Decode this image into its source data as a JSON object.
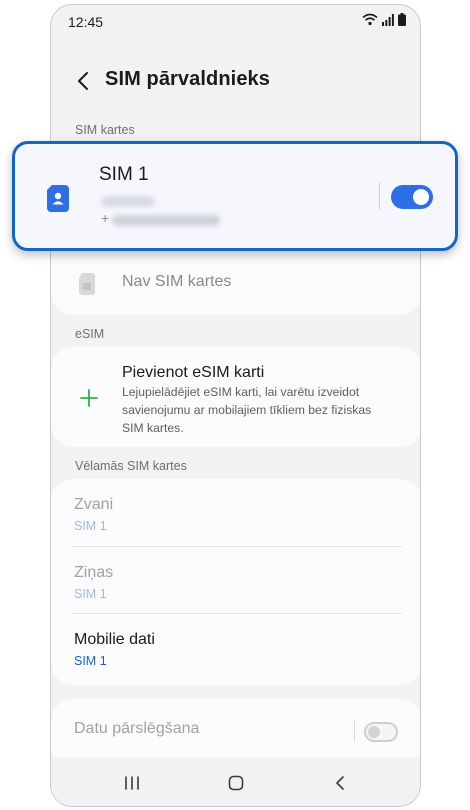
{
  "status_bar": {
    "time": "12:45"
  },
  "header": {
    "title": "SIM pārvaldnieks"
  },
  "sim_cards": {
    "section_label": "SIM kartes",
    "sim1": {
      "title": "SIM 1",
      "number_prefix": "+",
      "enabled": true
    },
    "no_sim": {
      "label": "Nav SIM kartes"
    }
  },
  "esim": {
    "section_label": "eSIM",
    "add_title": "Pievienot eSIM karti",
    "add_desc_line1": "Lejupielādējiet eSIM karti, lai varētu izveidot",
    "add_desc_line2": "savienojumu ar mobilajiem tīkliem bez fiziskas",
    "add_desc_line3": "SIM kartes."
  },
  "preferred": {
    "section_label": "Vēlamās SIM kartes",
    "items": [
      {
        "title": "Zvani",
        "value": "SIM 1"
      },
      {
        "title": "Ziņas",
        "value": "SIM 1"
      },
      {
        "title": "Mobilie dati",
        "value": "SIM 1"
      }
    ]
  },
  "data_switching": {
    "label": "Datu pārslēgšana",
    "enabled": false
  },
  "colors": {
    "accent": "#1565c8",
    "toggle_on": "#2e6fe6",
    "add_green": "#2bb24c",
    "value_blue": "#1a63c4"
  }
}
